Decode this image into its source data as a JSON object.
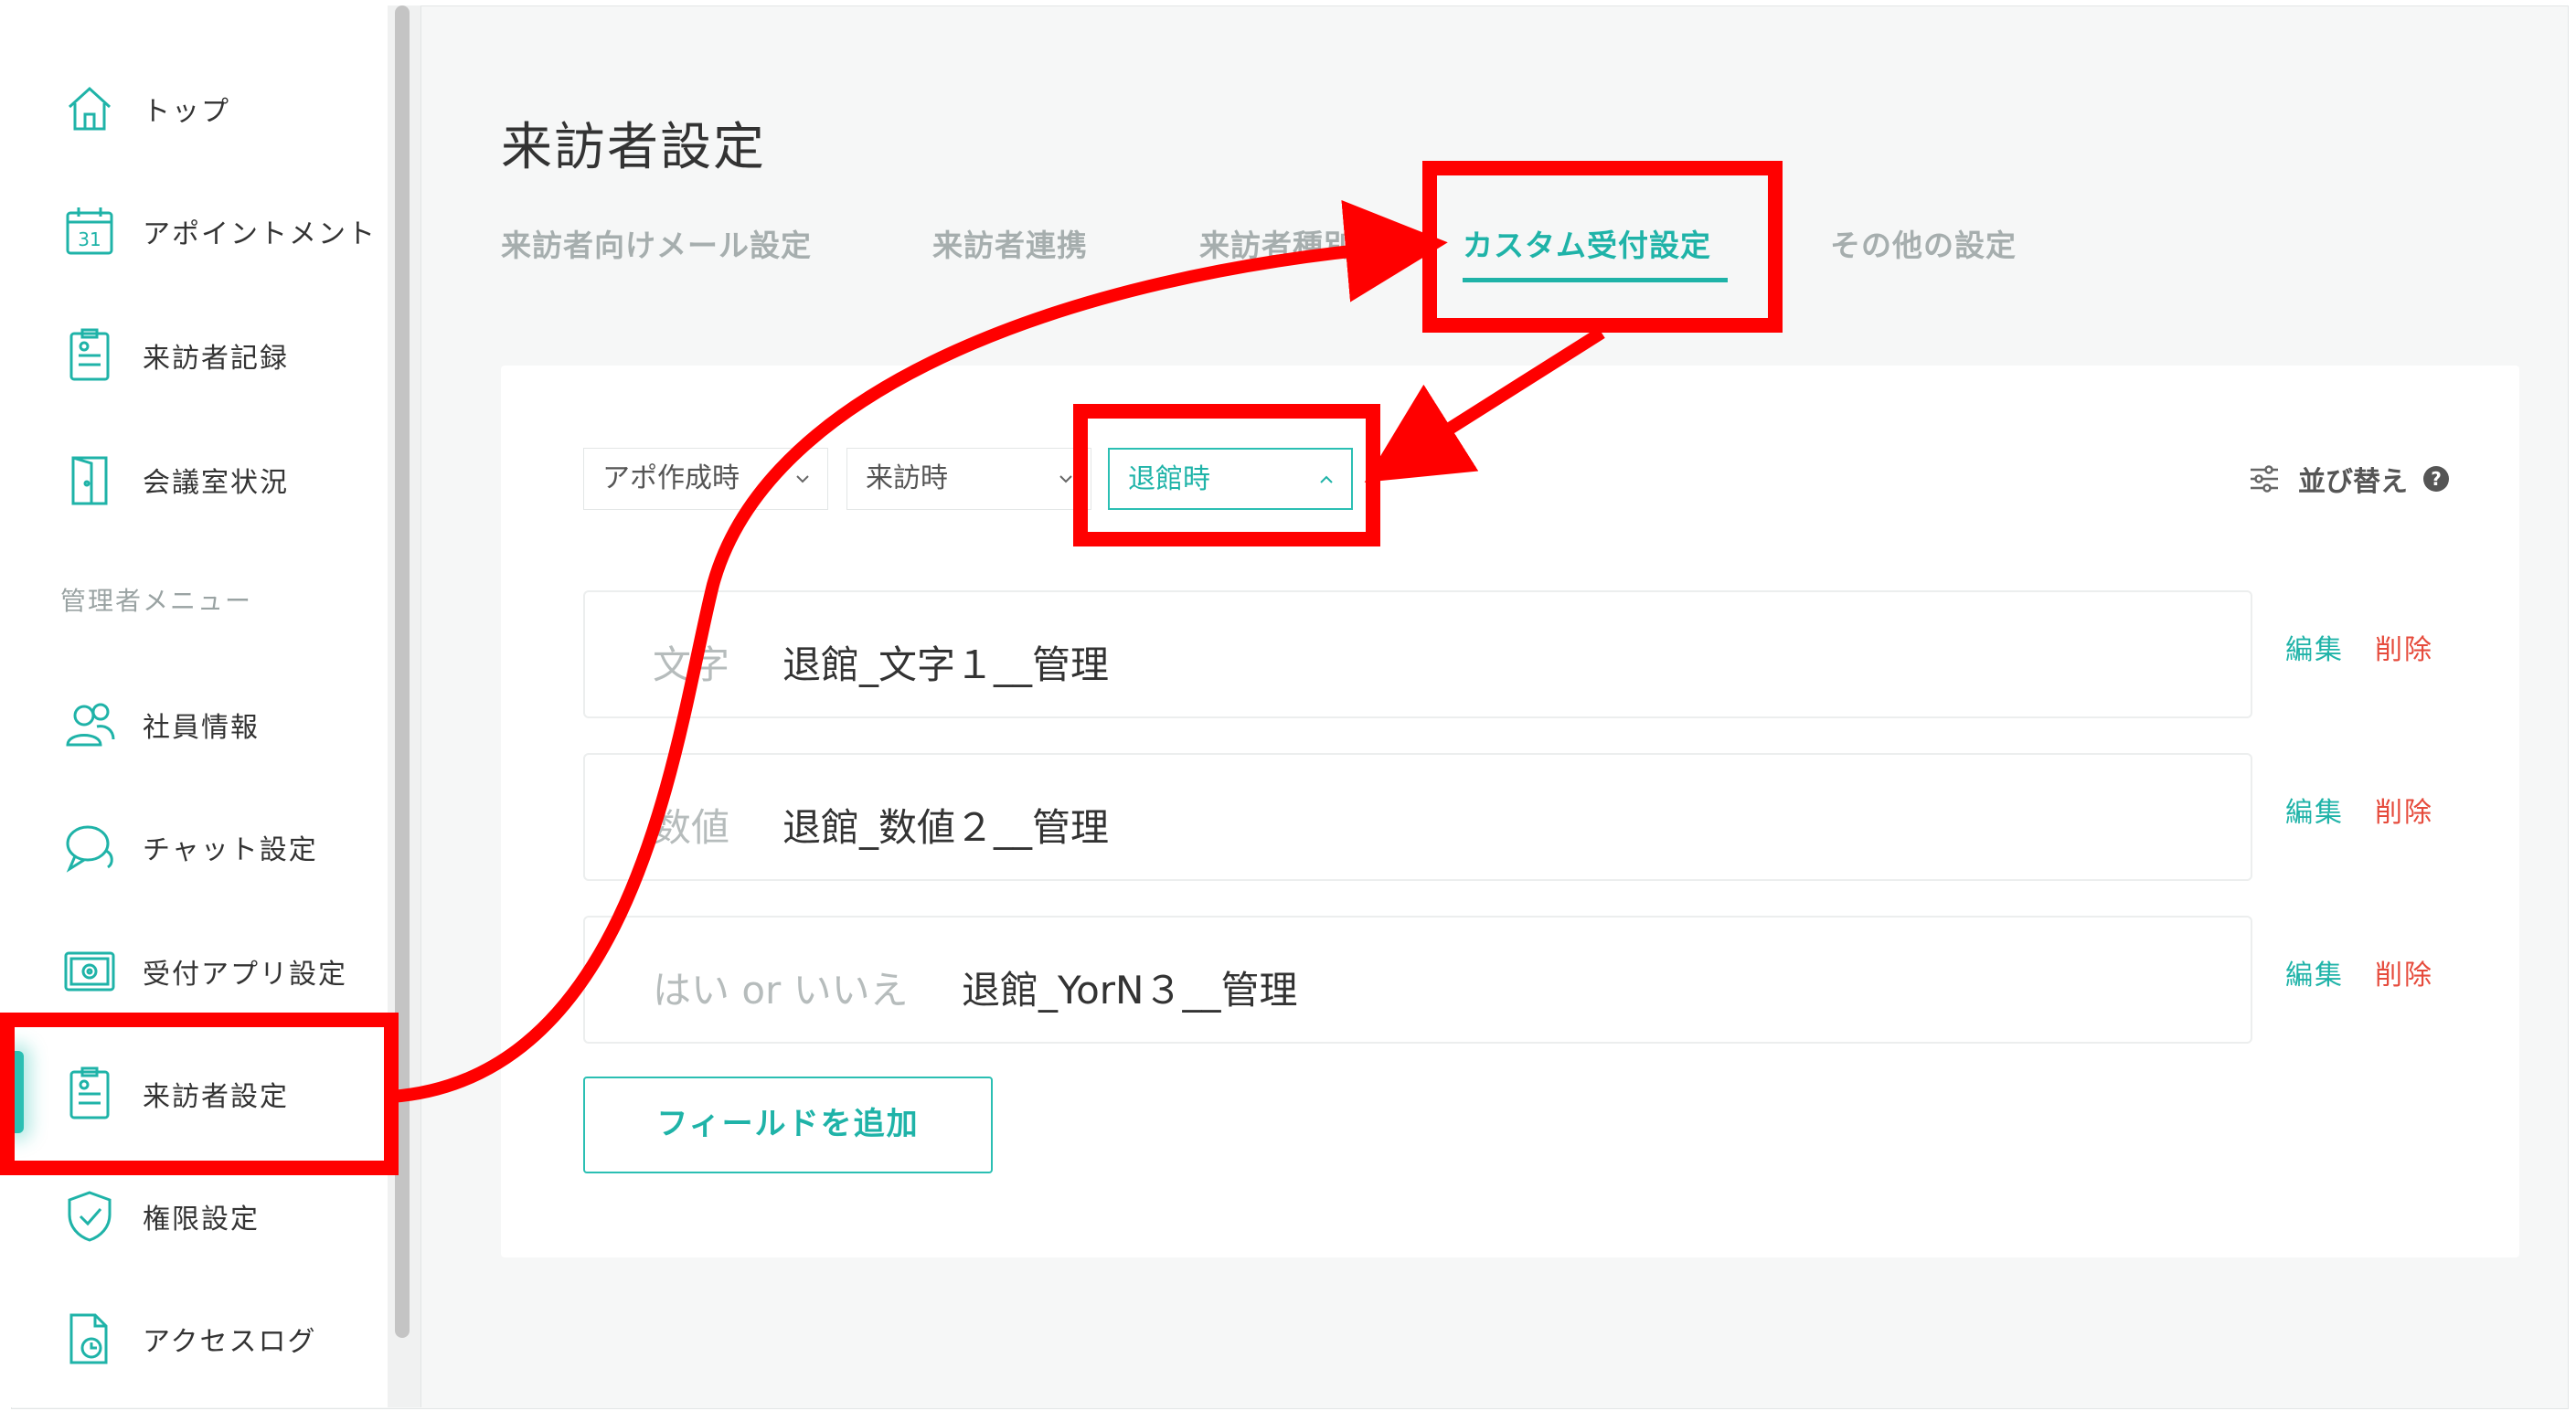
{
  "page": {
    "title": "来訪者設定"
  },
  "sidebar": {
    "items": [
      {
        "label": "トップ",
        "icon": "home-icon"
      },
      {
        "label": "アポイントメント",
        "icon": "calendar-icon"
      },
      {
        "label": "来訪者記録",
        "icon": "clipboard-icon"
      },
      {
        "label": "会議室状況",
        "icon": "door-icon"
      },
      {
        "label": "社員情報",
        "icon": "users-icon"
      },
      {
        "label": "チャット設定",
        "icon": "chat-icon"
      },
      {
        "label": "受付アプリ設定",
        "icon": "tablet-gear-icon"
      },
      {
        "label": "来訪者設定",
        "icon": "clipboard-icon"
      },
      {
        "label": "権限設定",
        "icon": "shield-icon"
      },
      {
        "label": "アクセスログ",
        "icon": "file-clock-icon"
      }
    ],
    "admin_section_label": "管理者メニュー",
    "active_item": "来訪者設定"
  },
  "tabs": [
    {
      "label": "来訪者向けメール設定"
    },
    {
      "label": "来訪者連携"
    },
    {
      "label": "来訪者種別"
    },
    {
      "label": "カスタム受付設定"
    },
    {
      "label": "その他の設定"
    }
  ],
  "active_tab": "カスタム受付設定",
  "filters": [
    {
      "label": "アポ作成時"
    },
    {
      "label": "来訪時"
    },
    {
      "label": "退館時"
    }
  ],
  "sort": {
    "label": "並び替え"
  },
  "fields": [
    {
      "type": "文字",
      "name": "退館_文字１__管理",
      "edit": "編集",
      "delete": "削除"
    },
    {
      "type": "数値",
      "name": "退館_数値２__管理",
      "edit": "編集",
      "delete": "削除"
    },
    {
      "type": "はい or いいえ",
      "name": "退館_YorN３__管理",
      "edit": "編集",
      "delete": "削除"
    }
  ],
  "add_field_button": "フィールドを追加",
  "colors": {
    "accent": "#1fb3a8",
    "delete": "#e64b3c",
    "annotation": "#ff0000"
  }
}
